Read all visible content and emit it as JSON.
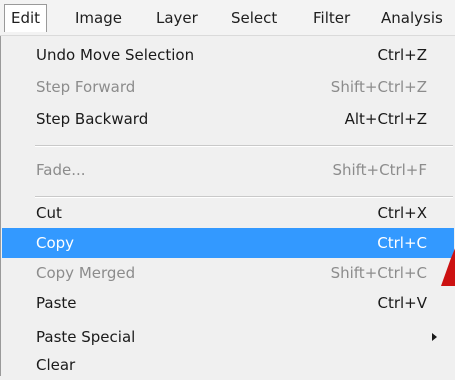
{
  "menubar": {
    "items": [
      "Edit",
      "Image",
      "Layer",
      "Select",
      "Filter",
      "Analysis"
    ]
  },
  "dropdown": {
    "items": [
      {
        "label": "Undo Move Selection",
        "shortcut": "Ctrl+Z"
      },
      {
        "label": "Step Forward",
        "shortcut": "Shift+Ctrl+Z",
        "disabled": true
      },
      {
        "label": "Step Backward",
        "shortcut": "Alt+Ctrl+Z"
      },
      {
        "label": "Fade...",
        "shortcut": "Shift+Ctrl+F",
        "disabled": true
      },
      {
        "label": "Cut",
        "shortcut": "Ctrl+X"
      },
      {
        "label": "Copy",
        "shortcut": "Ctrl+C",
        "highlighted": true
      },
      {
        "label": "Copy Merged",
        "shortcut": "Shift+Ctrl+C",
        "disabled": true
      },
      {
        "label": "Paste",
        "shortcut": "Ctrl+V"
      },
      {
        "label": "Paste Special",
        "shortcut": "",
        "has_submenu": true
      },
      {
        "label": "Clear",
        "shortcut": ""
      }
    ]
  },
  "colors": {
    "highlight": "#3399ff",
    "disabled_text": "#8c8c8c",
    "marker": "#cc1111"
  }
}
